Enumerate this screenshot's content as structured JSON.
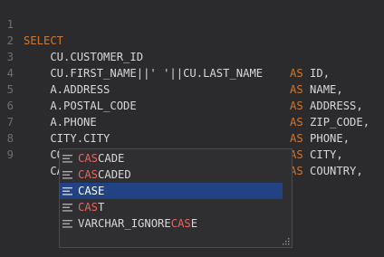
{
  "editor": {
    "lines": [
      {
        "num": "1",
        "code": "SELECT",
        "kw": "",
        "alias": ""
      },
      {
        "num": "2",
        "code": "    CU.CUSTOMER_ID",
        "kw": "AS",
        "alias": " ID,"
      },
      {
        "num": "3",
        "code": "    CU.FIRST_NAME||' '||CU.LAST_NAME",
        "kw": "AS",
        "alias": " NAME,"
      },
      {
        "num": "4",
        "code": "    A.ADDRESS",
        "kw": "AS",
        "alias": " ADDRESS,"
      },
      {
        "num": "5",
        "code": "    A.POSTAL_CODE",
        "kw": "AS",
        "alias": " ZIP_CODE,"
      },
      {
        "num": "6",
        "code": "    A.PHONE",
        "kw": "AS",
        "alias": " PHONE,"
      },
      {
        "num": "7",
        "code": "    CITY.CITY",
        "kw": "AS",
        "alias": " CITY,"
      },
      {
        "num": "8",
        "code": "    COUNTRY.COUNTRY",
        "kw": "AS",
        "alias": " COUNTRY,"
      },
      {
        "num": "9",
        "code": "    CAS",
        "kw": "",
        "alias": ""
      }
    ]
  },
  "autocomplete": {
    "items": [
      {
        "match": "CAS",
        "rest": "CADE",
        "selected": false
      },
      {
        "match": "CAS",
        "rest": "CADED",
        "selected": false
      },
      {
        "match": "CAS",
        "rest": "E",
        "selected": true
      },
      {
        "match": "CAS",
        "rest": "T",
        "selected": false
      },
      {
        "prefix": "VARCHAR_IGNORE",
        "match": "CAS",
        "rest": "E",
        "selected": false
      }
    ]
  },
  "colors": {
    "background": "#2b2b2d",
    "keyword": "#cc7832",
    "match": "#e0685f",
    "selection": "#214283"
  }
}
